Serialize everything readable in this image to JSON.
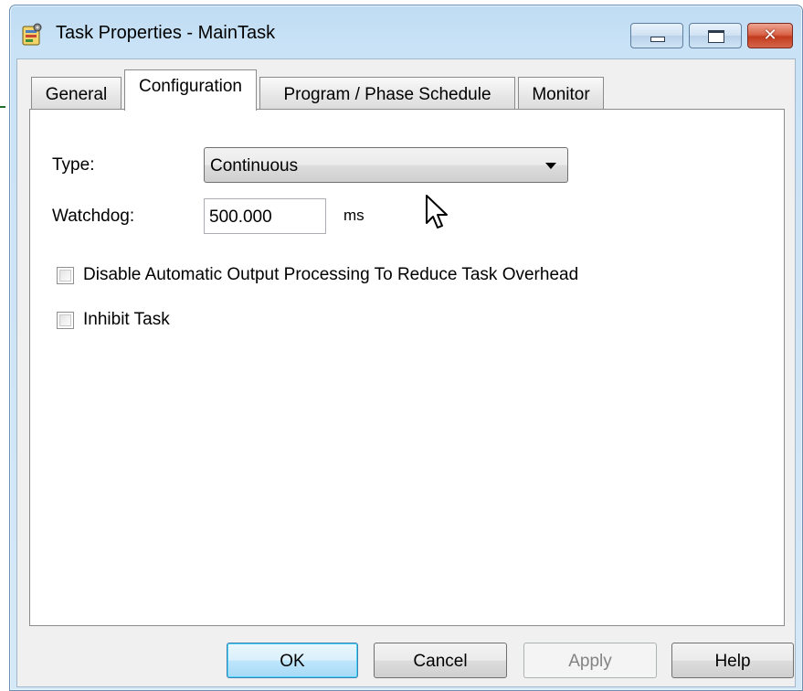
{
  "window": {
    "title": "Task Properties - MainTask",
    "close_symbol": "✕"
  },
  "tabs": [
    {
      "label": "General",
      "active": false
    },
    {
      "label": "Configuration",
      "active": true
    },
    {
      "label": "Program / Phase Schedule",
      "active": false
    },
    {
      "label": "Monitor",
      "active": false
    }
  ],
  "config": {
    "type_label": "Type:",
    "type_value": "Continuous",
    "watchdog_label": "Watchdog:",
    "watchdog_value": "500.000",
    "watchdog_unit": "ms",
    "disable_output_label": "Disable Automatic Output Processing To Reduce Task Overhead",
    "disable_output_checked": false,
    "inhibit_label": "Inhibit Task",
    "inhibit_checked": false
  },
  "buttons": {
    "ok": "OK",
    "cancel": "Cancel",
    "apply": "Apply",
    "help": "Help"
  },
  "icons": {
    "app": "task-properties-icon",
    "minimize": "minimize-icon",
    "maximize": "maximize-icon",
    "close": "close-icon",
    "cursor": "mouse-pointer-icon",
    "dropdown": "chevron-down-icon"
  },
  "colors": {
    "title_bar": "#c9e2f6",
    "close_button": "#c33c1e",
    "default_button_border": "#3c7fb1",
    "disabled_text": "#838383"
  }
}
